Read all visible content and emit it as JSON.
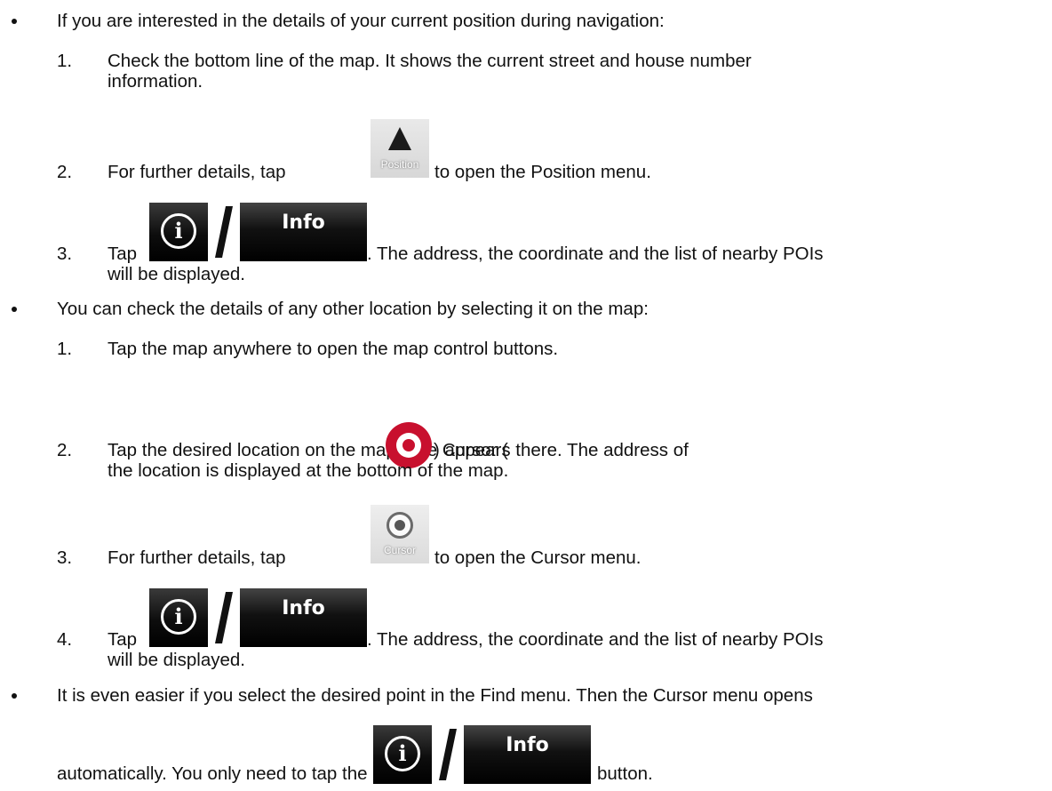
{
  "bullets": [
    {
      "text": "If you are interested in the details of your current position during navigation:",
      "steps": [
        {
          "num": "1.",
          "line1": "Check the bottom line of the map. It shows the current street and house number",
          "line2": "information."
        },
        {
          "num": "2.",
          "before": "For further details, tap",
          "after": "to open the Position menu."
        },
        {
          "num": "3.",
          "before": "Tap",
          "after": ". The address, the coordinate and the list of nearby POIs",
          "line2": "will be displayed."
        }
      ]
    },
    {
      "text": "You can check the details of any other location by selecting it on the map:",
      "steps": [
        {
          "num": "1.",
          "line1": "Tap the map anywhere to open the map control buttons."
        },
        {
          "num": "2.",
          "before": "Tap the desired location on the map. The Cursor (",
          "after": ") appears there. The address of",
          "line2": "the location is displayed at the bottom of the map."
        },
        {
          "num": "3.",
          "before": "For further details, tap",
          "after": "to open the Cursor menu."
        },
        {
          "num": "4.",
          "before": "Tap",
          "after": ". The address, the coordinate and the list of nearby POIs",
          "line2": "will be displayed."
        }
      ]
    },
    {
      "text": "It is even easier if you select the desired point in the Find menu. Then the Cursor menu opens",
      "line2_before": "automatically. You only need to tap the",
      "line2_after": "button."
    }
  ],
  "icons": {
    "position_label": "Position",
    "cursor_label": "Cursor",
    "info_glyph": "i",
    "info_label": "Info"
  },
  "colors": {
    "cursor_red": "#c8102e",
    "button_dark": "#0d0d0d"
  }
}
